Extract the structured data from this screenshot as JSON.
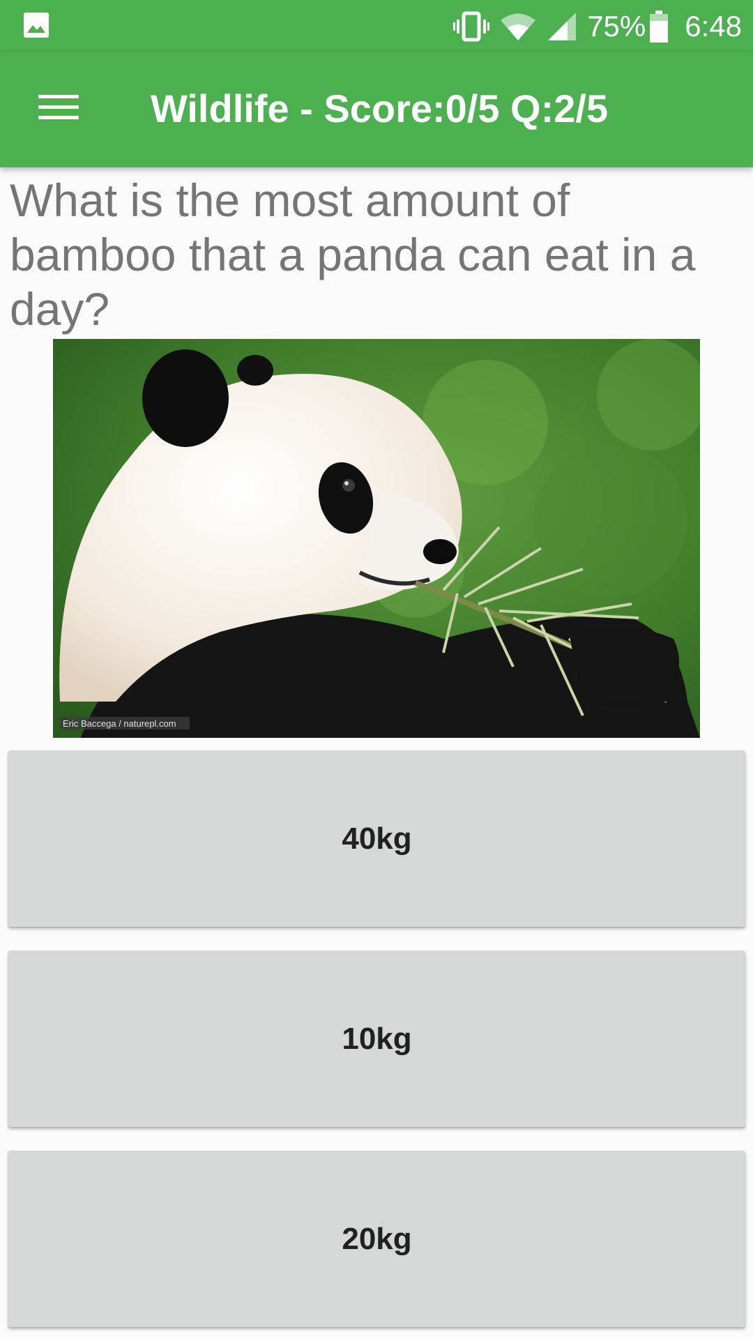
{
  "status_bar": {
    "battery_percent": "75%",
    "time": "6:48",
    "icons": [
      "gallery-icon",
      "vibrate-icon",
      "wifi-icon",
      "signal-icon",
      "battery-icon"
    ]
  },
  "app_bar": {
    "title": "Wildlife - Score:0/5 Q:2/5",
    "menu_icon": "hamburger-menu-icon"
  },
  "question": {
    "text": "What is the most amount of bamboo that a panda can eat in a day?",
    "image_caption": "Eric Baccega / naturepl.com"
  },
  "answers": [
    {
      "label": "40kg"
    },
    {
      "label": "10kg"
    },
    {
      "label": "20kg"
    }
  ],
  "colors": {
    "primary": "#4CAF50",
    "button_bg": "#D6D7D7",
    "question_text": "#757575"
  }
}
